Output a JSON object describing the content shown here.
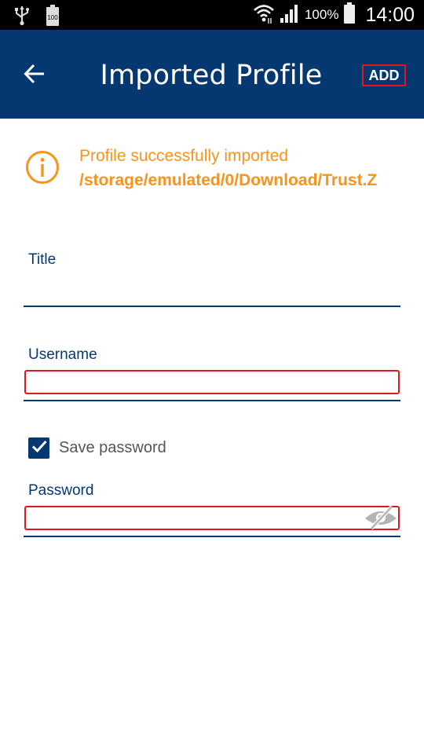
{
  "status_bar": {
    "battery_percent": "100%",
    "time": "14:00",
    "battery_small_label": "100",
    "icons": [
      "usb-icon",
      "battery-small-icon",
      "wifi-icon",
      "signal-icon",
      "battery-icon"
    ]
  },
  "app_bar": {
    "title": "Imported Profile",
    "back_icon": "arrow-left-icon",
    "add_label": "ADD"
  },
  "info": {
    "icon": "info-icon",
    "message": "Profile successfully imported",
    "path": "/storage/emulated/0/Download/Trust.Z"
  },
  "form": {
    "title_label": "Title",
    "title_value": "",
    "username_label": "Username",
    "username_value": "",
    "save_password_label": "Save password",
    "save_password_checked": true,
    "password_label": "Password",
    "password_value": "",
    "password_visibility_icon": "eye-off-icon"
  },
  "colors": {
    "primary": "#053871",
    "accent_orange": "#f7931e",
    "highlight_red": "#e3161f"
  }
}
